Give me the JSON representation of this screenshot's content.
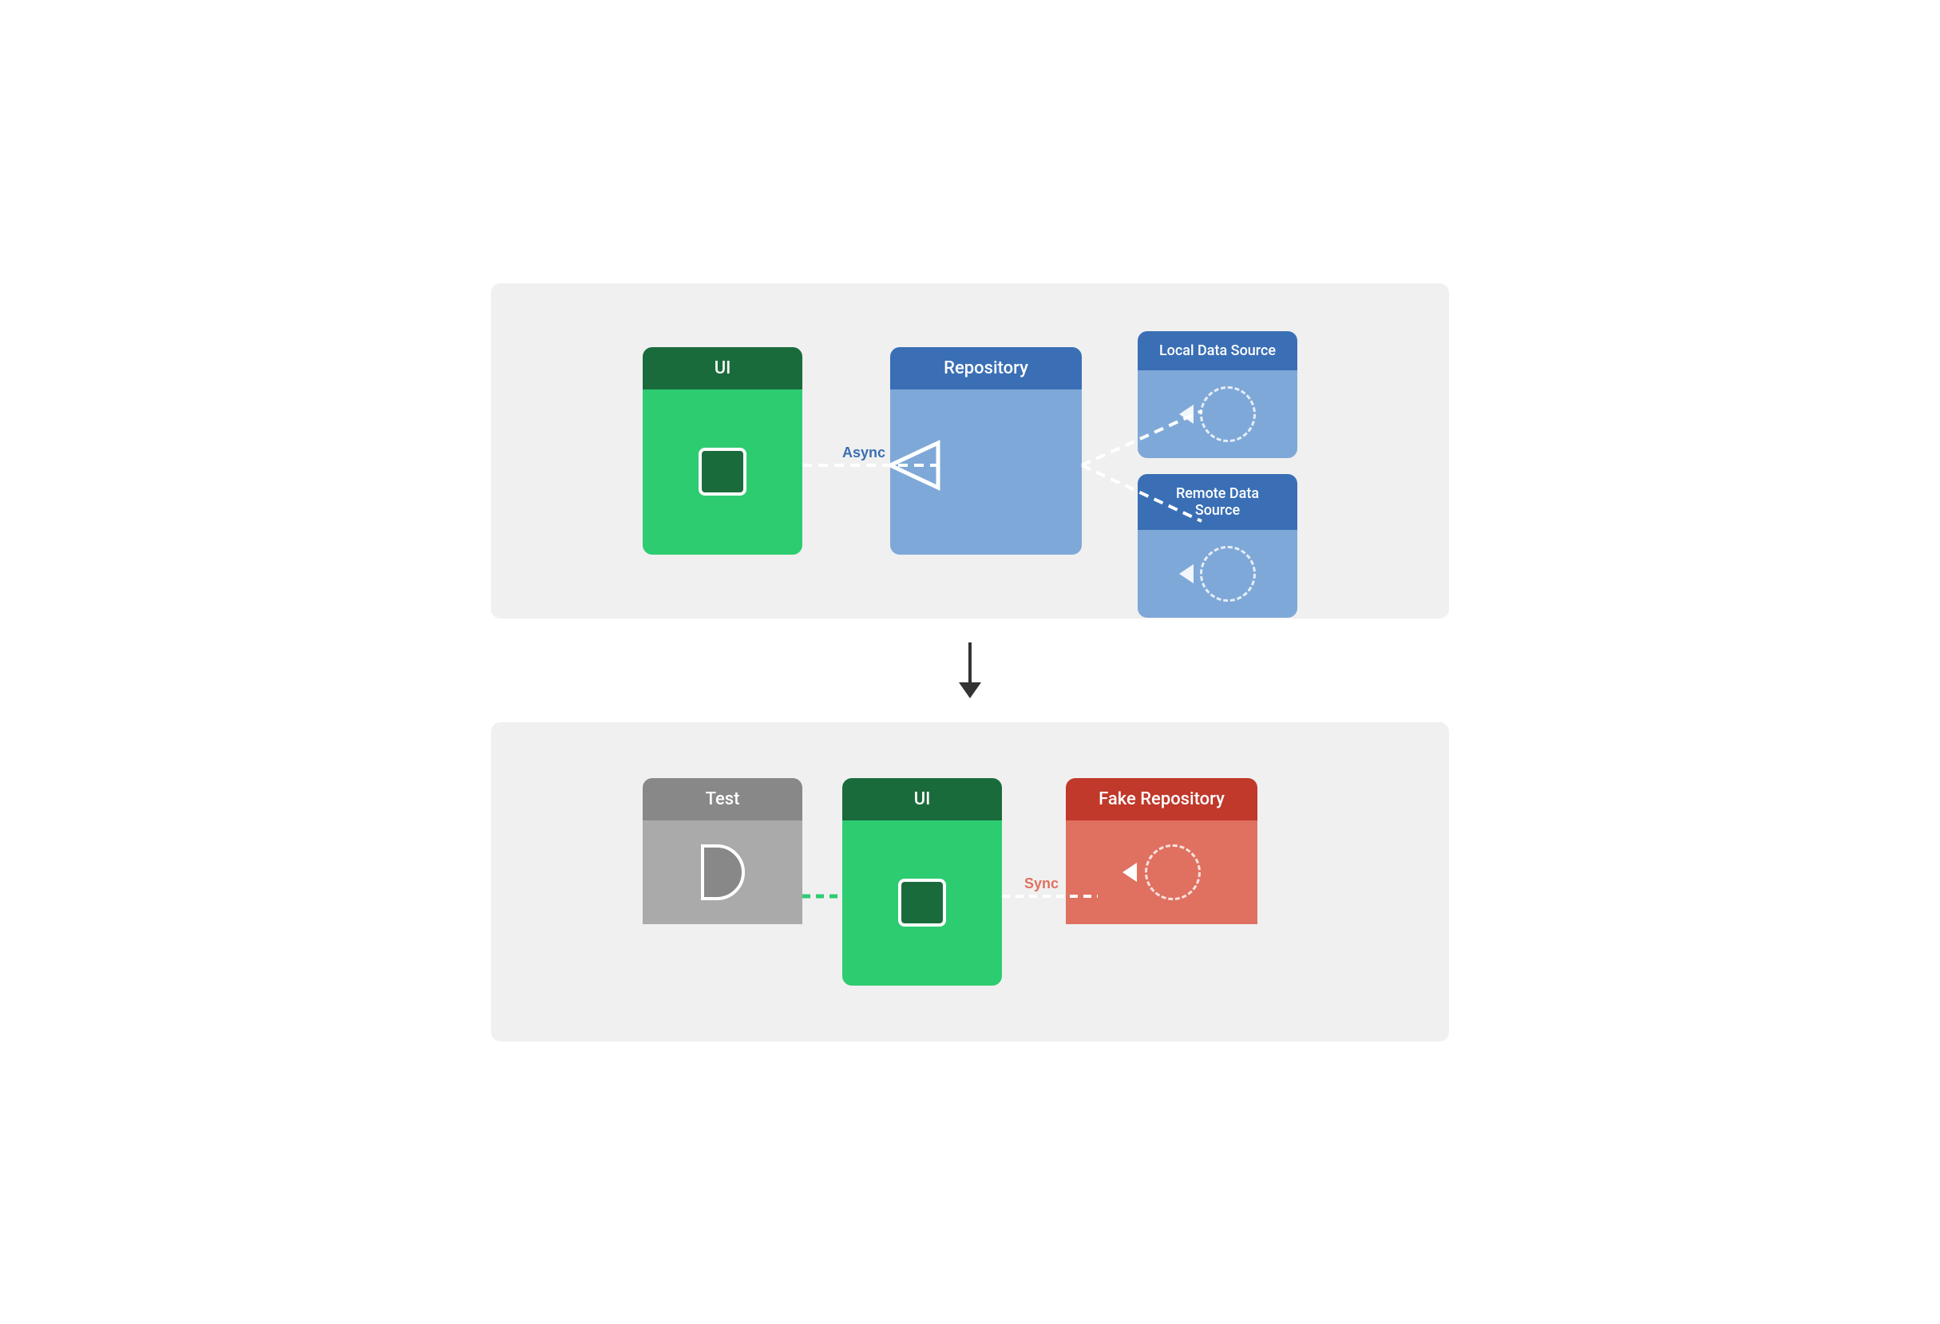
{
  "top_diagram": {
    "ui_block": {
      "header": "UI",
      "body_icon": "square"
    },
    "repo_block": {
      "header": "Repository"
    },
    "local_source": {
      "header": "Local Data Source"
    },
    "remote_source": {
      "header": "Remote Data Source"
    },
    "async_label": "Async"
  },
  "bottom_diagram": {
    "test_block": {
      "header": "Test"
    },
    "ui_block": {
      "header": "UI"
    },
    "fake_repo_block": {
      "header": "Fake Repository"
    },
    "sync_label": "Sync"
  },
  "arrow_down": "↓"
}
